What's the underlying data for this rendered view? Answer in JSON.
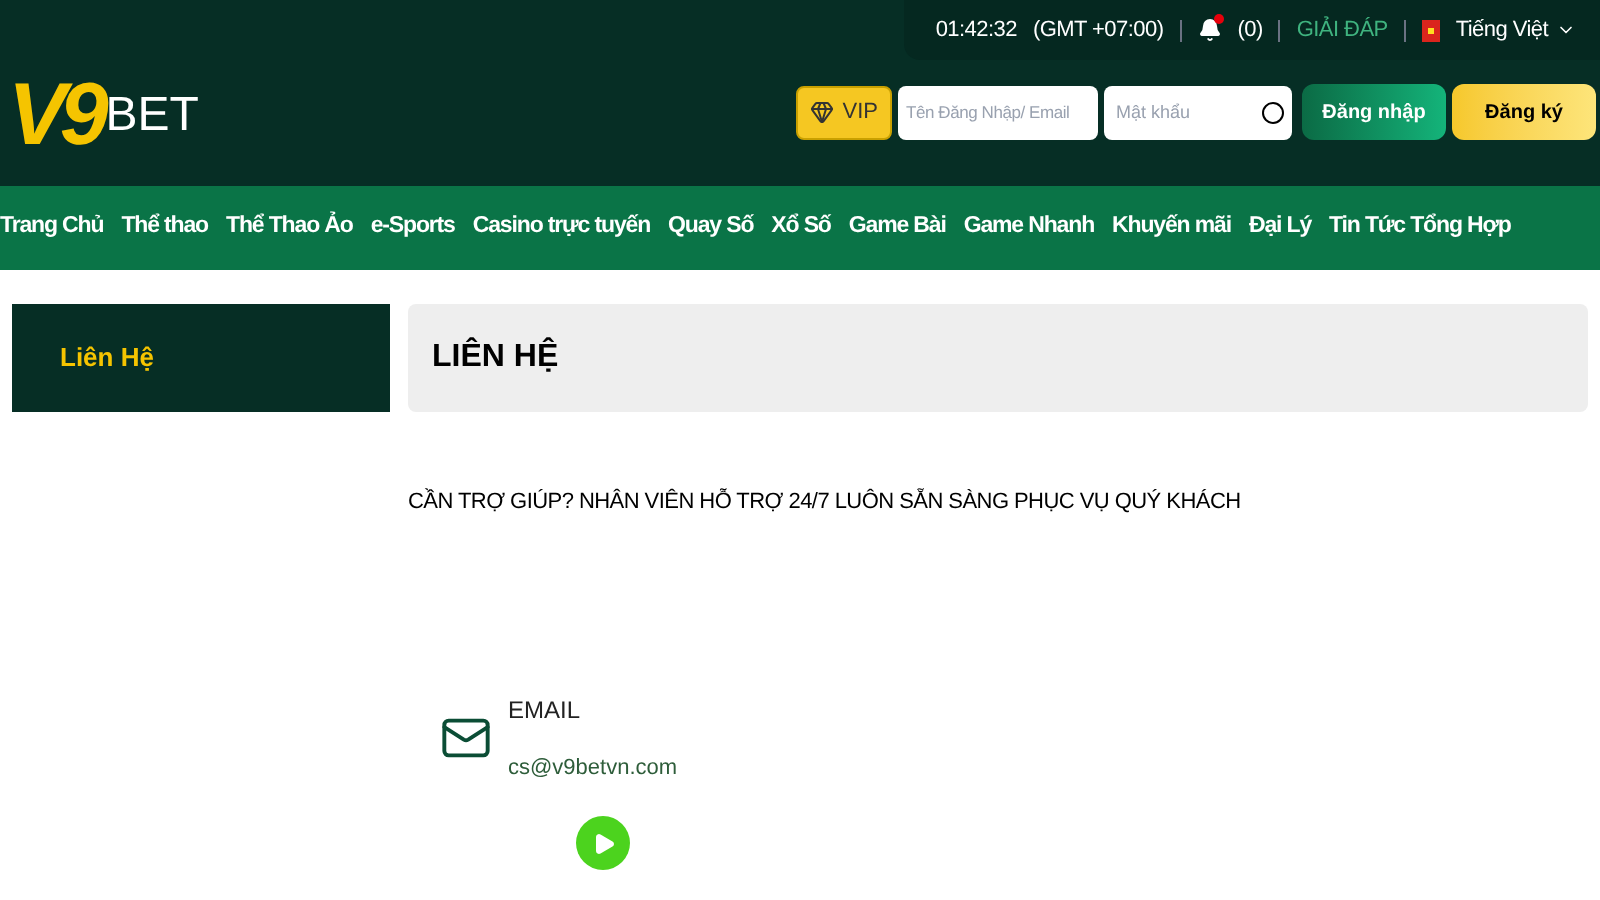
{
  "logo": {
    "mark": "V9",
    "word": "BET"
  },
  "topbar": {
    "time": "01:42:32",
    "timezone": "(GMT +07:00)",
    "notifications": "(0)",
    "help": "GIẢI ĐÁP",
    "language": "Tiếng Việt"
  },
  "login": {
    "vip": "VIP",
    "username": {
      "placeholder": "Tên Đăng Nhập/ Email"
    },
    "password": {
      "placeholder": "Mật khẩu"
    },
    "login_button": "Đăng nhập",
    "register_button": "Đăng ký"
  },
  "nav": [
    {
      "label": "Trang Chủ"
    },
    {
      "label": "Thể thao"
    },
    {
      "label": "Thể Thao Ảo"
    },
    {
      "label": "e-Sports"
    },
    {
      "label": "Casino trực tuyến"
    },
    {
      "label": "Quay Số"
    },
    {
      "label": "Xổ Số"
    },
    {
      "label": "Game Bài"
    },
    {
      "label": "Game Nhanh"
    },
    {
      "label": "Khuyến mãi"
    },
    {
      "label": "Đại Lý"
    },
    {
      "label": "Tin Tức Tổng Hợp"
    }
  ],
  "sidebar": {
    "items": [
      {
        "label": "Liên Hệ",
        "selected": true
      }
    ]
  },
  "content": {
    "title": "LIÊN HỆ",
    "intro": "CẦN TRỢ GIÚP? NHÂN VIÊN HỖ TRỢ 24/7 LUÔN SẴN SÀNG PHỤC VỤ QUÝ KHÁCH",
    "contacts": [
      {
        "kind": "email",
        "label": "EMAIL",
        "value": "cs@v9betvn.com"
      }
    ]
  }
}
